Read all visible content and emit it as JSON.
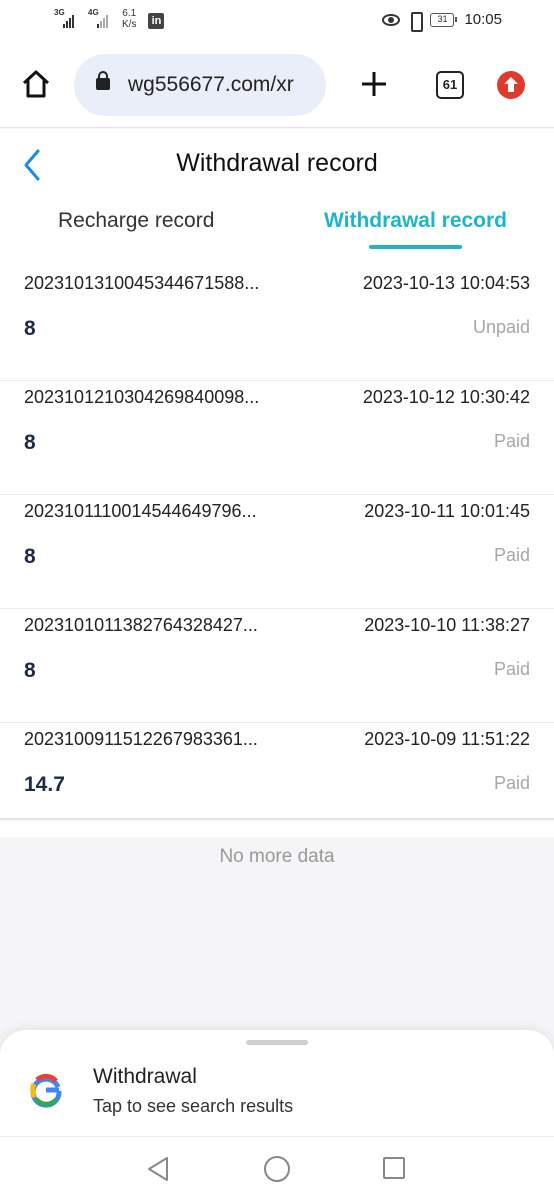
{
  "status_bar": {
    "network_1": "3G",
    "network_2": "4G",
    "speed_value": "6.1",
    "speed_unit": "K/s",
    "linkedin": "in",
    "battery": "31",
    "time": "10:05"
  },
  "browser": {
    "url": "wg556677.com/xr",
    "tab_count": "61",
    "accent_color": "#e03a2d"
  },
  "page": {
    "title": "Withdrawal record",
    "tabs": [
      {
        "label": "Recharge record",
        "active": false
      },
      {
        "label": "Withdrawal record",
        "active": true
      }
    ],
    "accent_color": "#1fb5c8"
  },
  "records": [
    {
      "order_id": "2023101310045344671588...",
      "timestamp": "2023-10-13 10:04:53",
      "amount": "8",
      "status": "Unpaid"
    },
    {
      "order_id": "2023101210304269840098...",
      "timestamp": "2023-10-12 10:30:42",
      "amount": "8",
      "status": "Paid"
    },
    {
      "order_id": "2023101110014544649796...",
      "timestamp": "2023-10-11 10:01:45",
      "amount": "8",
      "status": "Paid"
    },
    {
      "order_id": "2023101011382764328427...",
      "timestamp": "2023-10-10 11:38:27",
      "amount": "8",
      "status": "Paid"
    },
    {
      "order_id": "2023100911512267983361...",
      "timestamp": "2023-10-09 11:51:22",
      "amount": "14.7",
      "status": "Paid"
    }
  ],
  "no_more_text": "No more data",
  "google_sheet": {
    "title": "Withdrawal",
    "subtitle": "Tap to see search results"
  }
}
